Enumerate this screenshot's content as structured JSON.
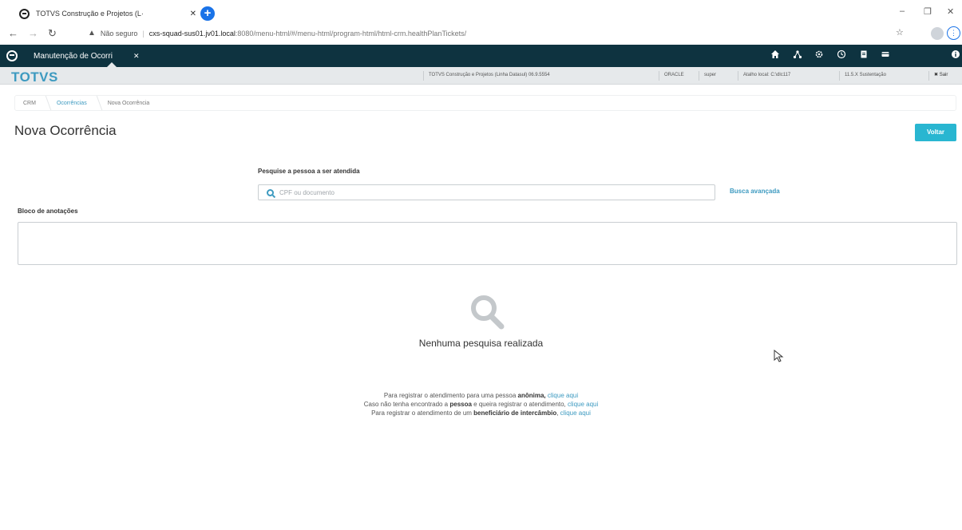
{
  "browser": {
    "tab_title": "TOTVS Construção e Projetos (L·",
    "tab_close": "✕",
    "new_tab": "+",
    "window_controls": {
      "minimize": "–",
      "maximize": "❐",
      "close": "✕"
    },
    "address": {
      "warning": "▲",
      "security_label": "Não seguro",
      "separator": "|",
      "host": "cxs-squad-sus01.jv01.local",
      "path": ":8080/menu-html/#/menu-html/program-html/html-crm.healthPlanTickets/"
    }
  },
  "app": {
    "tab_label": "Manutenção de Ocorri",
    "tab_close": "✕",
    "brand": "TOTVS",
    "info_items": [
      "TOTVS Construção e Projetos (Linha Datasul) 06.9.5554",
      "ORACLE",
      "super",
      "Atalho local: C:\\dlc117",
      "11.5.X Sustentação",
      "✖ Sair"
    ],
    "topbar_icons": [
      "home-icon",
      "network-icon",
      "gear-icon",
      "clock-icon",
      "document-icon",
      "card-icon",
      "info-icon"
    ]
  },
  "breadcrumb": {
    "items": [
      {
        "label": "CRM",
        "link": false
      },
      {
        "label": "Ocorrências",
        "link": true
      },
      {
        "label": "Nova Ocorrência",
        "link": false
      }
    ]
  },
  "page": {
    "title": "Nova Ocorrência",
    "back_label": "Voltar",
    "search_label": "Pesquise a pessoa a ser atendida",
    "search_placeholder": "CPF ou documento",
    "search_value": "",
    "advanced_search": "Busca avançada",
    "notes_label": "Bloco de anotações",
    "notes_value": ""
  },
  "empty_state": {
    "title": "Nenhuma pesquisa realizada",
    "line1_prefix": "Para registrar o atendimento para uma pessoa ",
    "line1_bold": "anônima,",
    "line1_link": "clique aqui",
    "line2_prefix": "Caso não tenha encontrado a ",
    "line2_bold": "pessoa",
    "line2_middle": " e queira registrar o atendimento, ",
    "line2_link": "clique aqui",
    "line3_prefix": "Para registrar o atendimento de um ",
    "line3_bold": "beneficiário de intercâmbio",
    "line3_middle": ", ",
    "line3_link": "clique aqui"
  },
  "colors": {
    "topbar": "#0e3340",
    "accent": "#3d9ac0",
    "button": "#29b6d1",
    "infobar": "#e6e9eb"
  }
}
